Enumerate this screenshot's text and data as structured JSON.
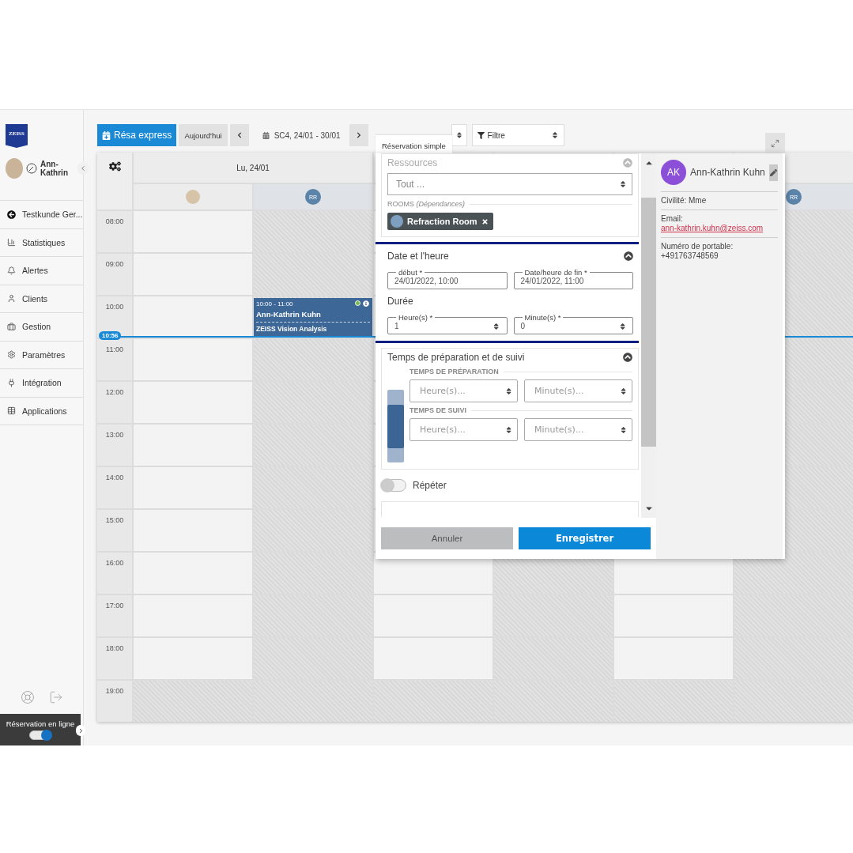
{
  "sidebar": {
    "logo": "ZEISS",
    "user": "Ann-Kathrin",
    "items": [
      {
        "label": "Testkunde Ger..."
      },
      {
        "label": "Statistiques"
      },
      {
        "label": "Alertes"
      },
      {
        "label": "Clients"
      },
      {
        "label": "Gestion"
      },
      {
        "label": "Paramètres"
      },
      {
        "label": "Intégration"
      },
      {
        "label": "Applications"
      }
    ],
    "online_booking": {
      "label": "Réservation en ligne",
      "on": true
    }
  },
  "toolbar": {
    "express": "Résa express",
    "today": "Aujourd'hui",
    "week": "SC4, 24/01 - 30/01",
    "filter": "Filtre"
  },
  "calendar": {
    "day": "Lu, 24/01",
    "now": "10:56",
    "columns": [
      {
        "kind": "photo",
        "unavailable": false
      },
      {
        "kind": "initials",
        "initials": "RR",
        "unavailable": true,
        "events": [
          {
            "time": "10:00 - 11:00",
            "title": "Ann-Kathrin Kuhn",
            "subtitle": "ZEISS Vision Analysis"
          }
        ]
      },
      {
        "kind": "plain",
        "unavailable": false
      },
      {
        "kind": "plain",
        "unavailable": true
      },
      {
        "kind": "plain",
        "unavailable": false
      },
      {
        "kind": "initials",
        "initials": "RR",
        "unavailable": true
      }
    ],
    "hours": [
      {
        "label": "08:00",
        "closed": false
      },
      {
        "label": "09:00",
        "closed": false
      },
      {
        "label": "10:00",
        "closed": false
      },
      {
        "label": "11:00",
        "closed": false
      },
      {
        "label": "12:00",
        "closed": false
      },
      {
        "label": "13:00",
        "closed": false
      },
      {
        "label": "14:00",
        "closed": false
      },
      {
        "label": "15:00",
        "closed": false
      },
      {
        "label": "16:00",
        "closed": false
      },
      {
        "label": "17:00",
        "closed": false
      },
      {
        "label": "18:00",
        "closed": false
      },
      {
        "label": "19:00",
        "closed": true
      }
    ]
  },
  "modal": {
    "tab": "Réservation simple",
    "resources": {
      "title": "Ressources",
      "select": "Tout ...",
      "group": "ROOMS",
      "group_note": "(Dépendances)",
      "chips": [
        {
          "label": "Refraction Room"
        }
      ]
    },
    "datetime": {
      "title": "Date et l'heure",
      "highlighted": true,
      "start": {
        "label": "début *",
        "value": "24/01/2022, 10:00"
      },
      "end": {
        "label": "Date/heure de fin *",
        "value": "24/01/2022, 11:00"
      },
      "duration_title": "Durée",
      "hours": {
        "label": "Heure(s) *",
        "value": "1"
      },
      "minutes": {
        "label": "Minute(s) *",
        "value": "0"
      }
    },
    "prep": {
      "title": "Temps de préparation et de suivi",
      "groups": [
        {
          "title": "TEMPS DE PRÉPARATION",
          "hours_placeholder": "Heure(s)...",
          "minutes_placeholder": "Minute(s)..."
        },
        {
          "title": "TEMPS DE SUIVI",
          "hours_placeholder": "Heure(s)...",
          "minutes_placeholder": "Minute(s)..."
        }
      ]
    },
    "repeat": {
      "label": "Répéter",
      "on": false
    },
    "cancel": "Annuler",
    "save": "Enregistrer",
    "client": {
      "initials": "AK",
      "name": "Ann-Kathrin Kuhn",
      "civility": "Civilité: Mme",
      "email_label": "Email:",
      "email": "ann-kathrin.kuhn@zeiss.com",
      "phone_label": "Numéro de portable:",
      "phone": "+491763748569"
    }
  }
}
